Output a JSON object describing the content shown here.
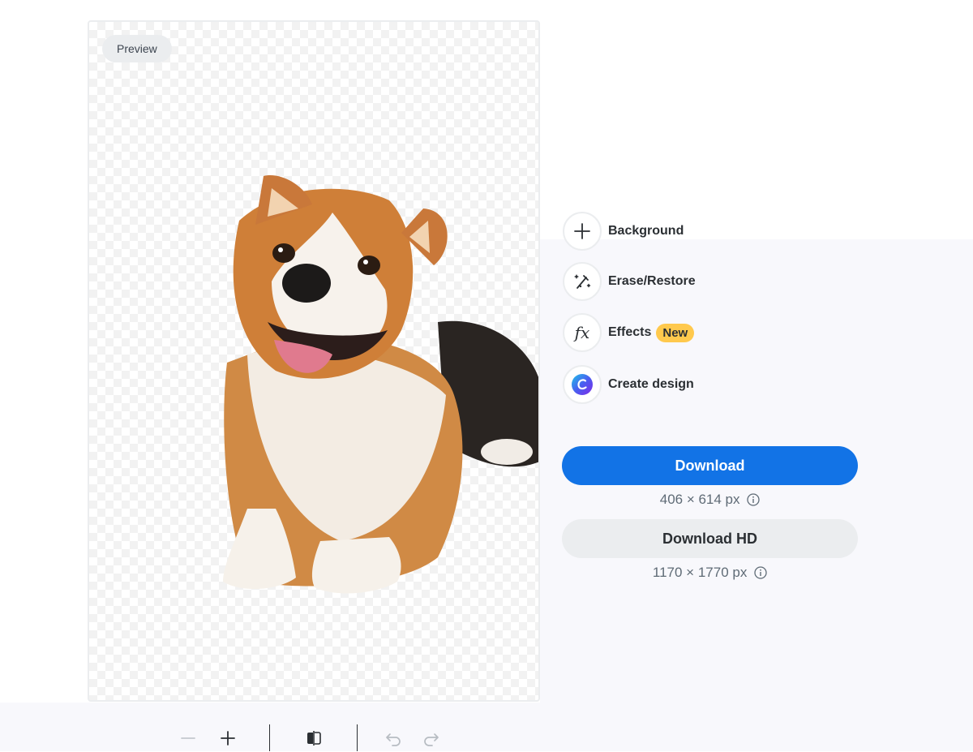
{
  "preview": {
    "label": "Preview"
  },
  "tools": [
    {
      "label": "Background",
      "icon": "plus-icon"
    },
    {
      "label": "Erase/Restore",
      "icon": "magic-brush-icon"
    },
    {
      "label": "Effects",
      "icon": "fx-icon",
      "badge": "New"
    },
    {
      "label": "Create design",
      "icon": "canva-logo-icon"
    }
  ],
  "download": {
    "label": "Download",
    "size": "406 × 614 px",
    "color": "#1273e6"
  },
  "download_hd": {
    "label": "Download HD",
    "size": "1170 × 1770 px"
  },
  "bottom_toolbar": {
    "icons": [
      "zoom-out-icon",
      "zoom-in-icon",
      "compare-icon",
      "undo-icon",
      "redo-icon"
    ]
  },
  "colors": {
    "accent": "#1273e6",
    "badge": "#ffc94d",
    "panel_bg": "#f8f8fc"
  }
}
